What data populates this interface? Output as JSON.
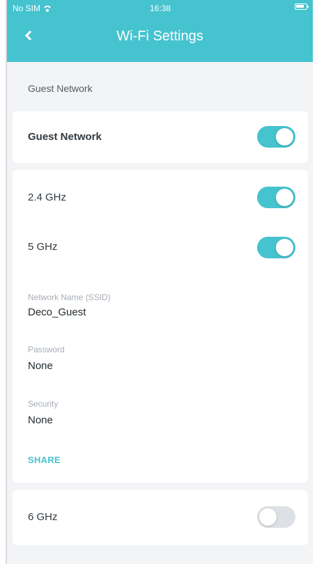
{
  "status_bar": {
    "carrier": "No SIM",
    "time": "16:38",
    "battery": "battery-icon",
    "signal": "wifi-icon"
  },
  "header": {
    "title": "Wi-Fi Settings",
    "back_icon": "chevron-left-icon",
    "background_color": "#45c3cf"
  },
  "section": {
    "label": "Guest Network"
  },
  "guest_network": {
    "label": "Guest Network",
    "enabled": true
  },
  "bands": {
    "band_24": {
      "label": "2.4 GHz",
      "enabled": true
    },
    "band_5": {
      "label": "5 GHz",
      "enabled": true
    },
    "ssid": {
      "label": "Network Name (SSID)",
      "value": "Deco_Guest"
    },
    "password": {
      "label": "Password",
      "value": "None"
    },
    "security": {
      "label": "Security",
      "value": "None"
    },
    "share_label": "SHARE"
  },
  "band_6": {
    "label": "6 GHz",
    "enabled": false
  },
  "colors": {
    "accent": "#45c3cf",
    "page_background": "#f3f4f6",
    "card_background": "#ffffff",
    "toggle_off": "#dde1e5"
  }
}
